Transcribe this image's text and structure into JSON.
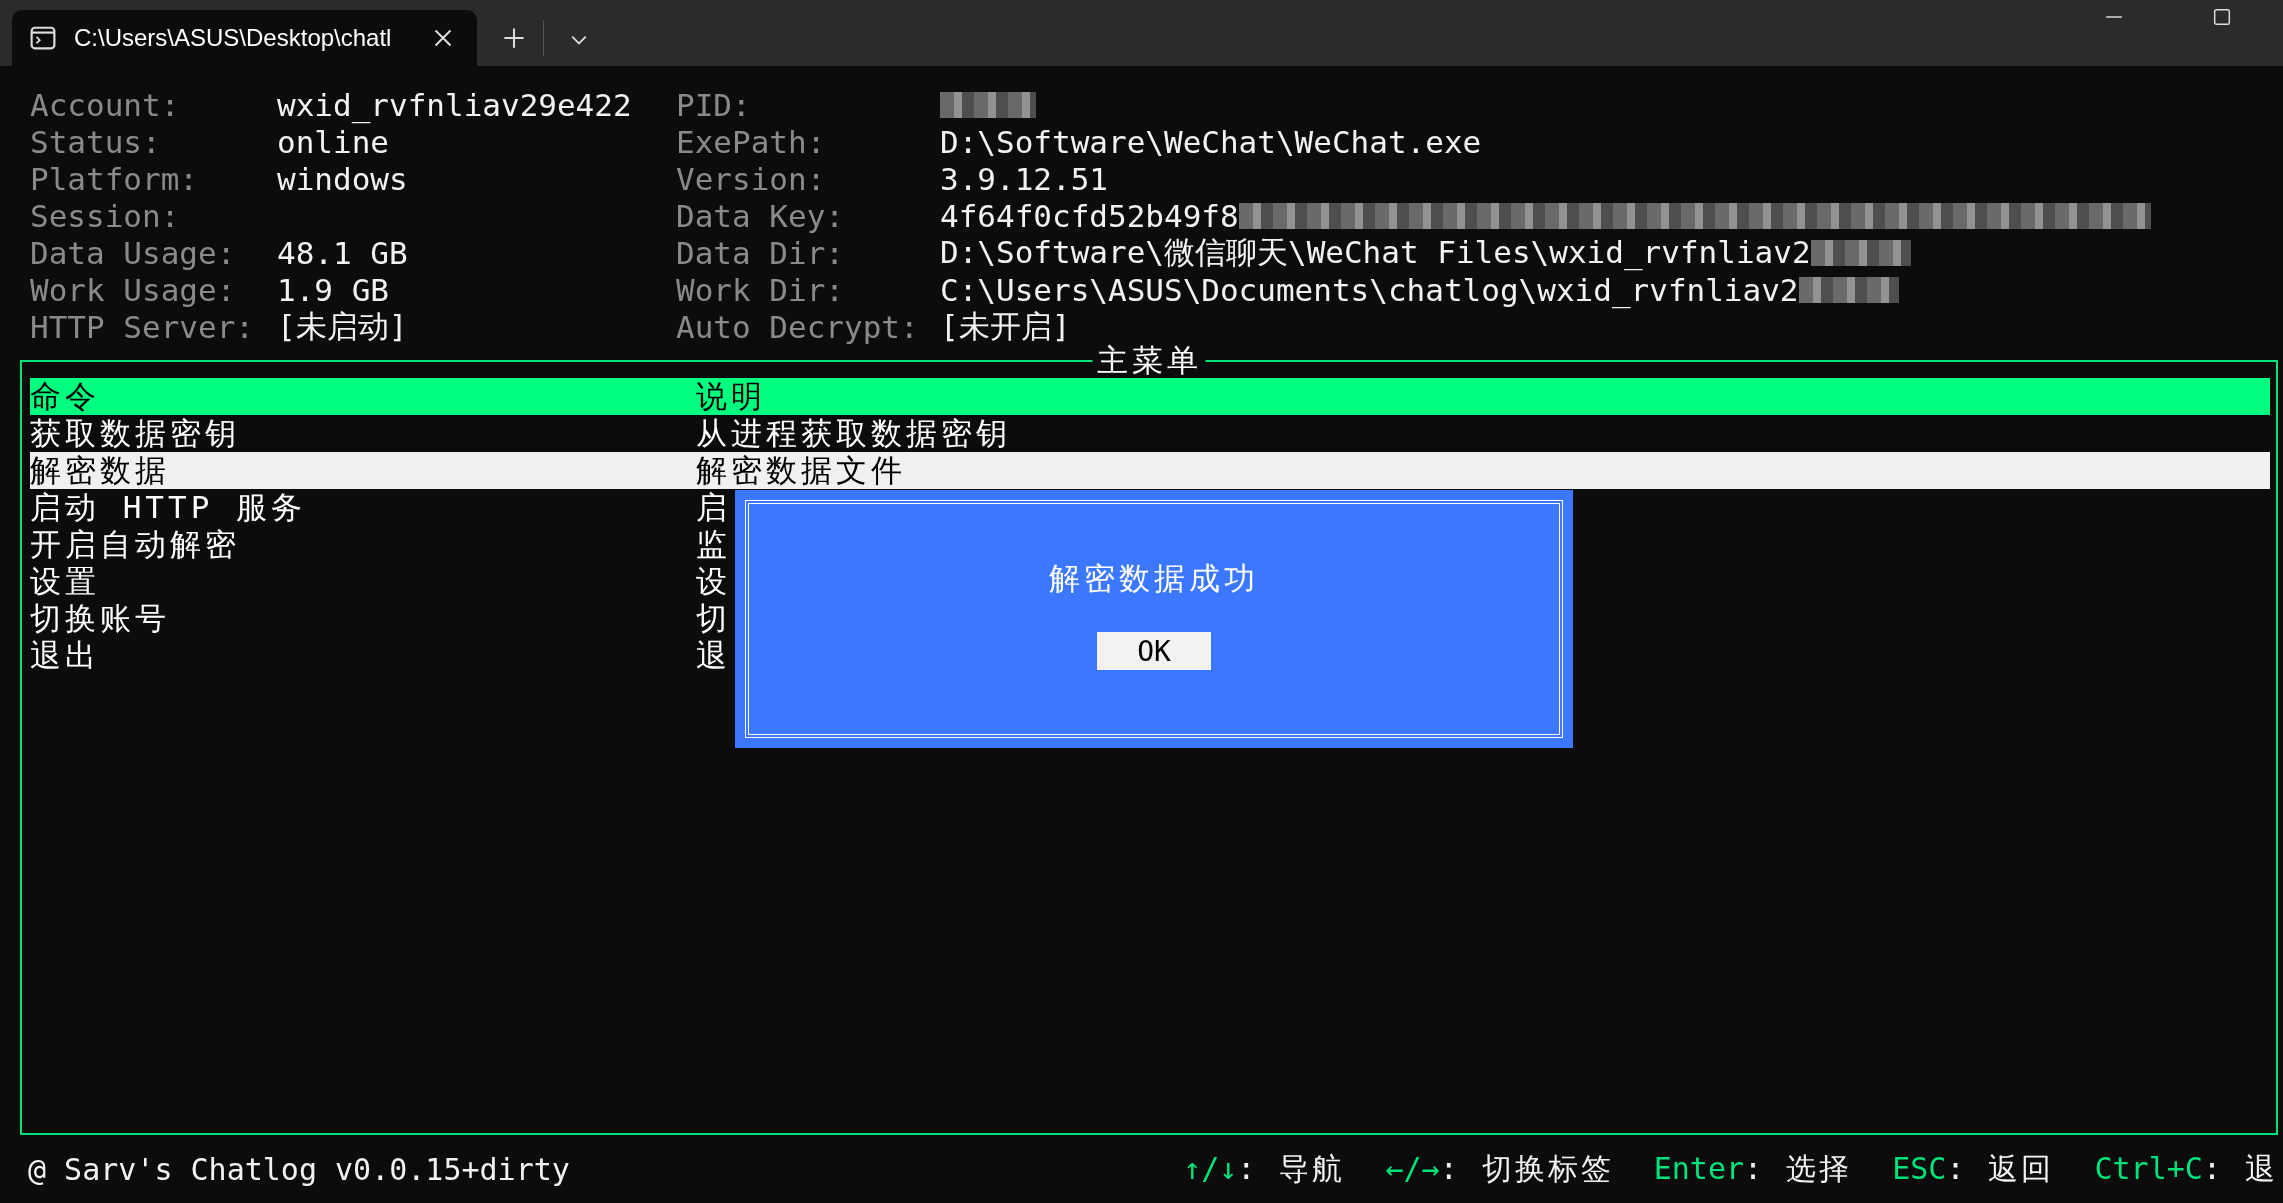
{
  "tab": {
    "title": "C:\\Users\\ASUS\\Desktop\\chatl"
  },
  "info_left": [
    {
      "label": "Account:",
      "value": "wxid_rvfnliav29e422"
    },
    {
      "label": "Status:",
      "value": "online"
    },
    {
      "label": "Platform:",
      "value": "windows"
    },
    {
      "label": "Session:"
    },
    {
      "label": "Data Usage:",
      "value": "48.1 GB"
    },
    {
      "label": "Work Usage:",
      "value": "1.9 GB"
    },
    {
      "label": "HTTP Server:",
      "value": "[未启动]"
    }
  ],
  "info_right": [
    {
      "label": "PID:",
      "blurred": true
    },
    {
      "label": "ExePath:",
      "value": "D:\\Software\\WeChat\\WeChat.exe"
    },
    {
      "label": "Version:",
      "value": "3.9.12.51"
    },
    {
      "label": "Data Key:",
      "value": "4f64f0cfd52b49f8",
      "blurred": true
    },
    {
      "label": "Data Dir:",
      "value": "D:\\Software\\微信聊天\\WeChat Files\\wxid_rvfnliav2",
      "blurred": true
    },
    {
      "label": "Work Dir:",
      "value": "C:\\Users\\ASUS\\Documents\\chatlog\\wxid_rvfnliav2",
      "blurred": true
    },
    {
      "label": "Auto Decrypt:",
      "value": "[未开启]"
    }
  ],
  "menu": {
    "title": "主菜单",
    "columns": [
      "命令",
      "说明"
    ],
    "rows": [
      {
        "command": "获取数据密钥",
        "description": "从进程获取数据密钥",
        "selected": false
      },
      {
        "command": "解密数据",
        "description": "解密数据文件",
        "selected": true
      },
      {
        "command": "启动 HTTP 服务",
        "description": "启",
        "selected": false
      },
      {
        "command": "开启自动解密",
        "description": "监",
        "selected": false
      },
      {
        "command": "设置",
        "description": "设",
        "selected": false
      },
      {
        "command": "切换账号",
        "description": "切",
        "selected": false
      },
      {
        "command": "退出",
        "description": "退",
        "selected": false
      }
    ]
  },
  "dialog": {
    "message": "解密数据成功",
    "button": "OK"
  },
  "status_bar": {
    "version": "@ Sarv's Chatlog v0.0.15+dirty",
    "shortcuts": [
      {
        "key": "↑/↓",
        "action": ": 导航"
      },
      {
        "key": "←/→",
        "action": ": 切换标签"
      },
      {
        "key": "Enter",
        "action": ": 选择"
      },
      {
        "key": "ESC",
        "action": ": 返回"
      },
      {
        "key": "Ctrl+C",
        "action": ": 退"
      }
    ]
  }
}
